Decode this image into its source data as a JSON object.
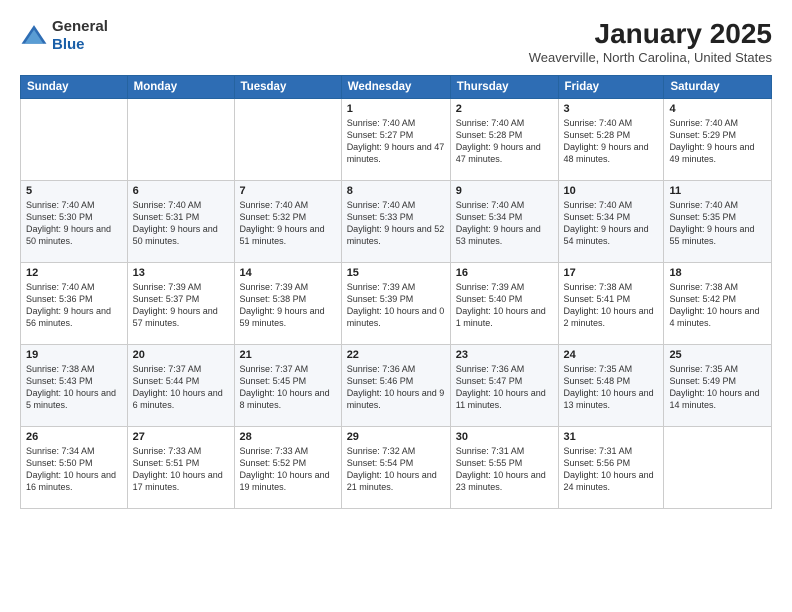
{
  "logo": {
    "general": "General",
    "blue": "Blue"
  },
  "header": {
    "month": "January 2025",
    "location": "Weaverville, North Carolina, United States"
  },
  "days_of_week": [
    "Sunday",
    "Monday",
    "Tuesday",
    "Wednesday",
    "Thursday",
    "Friday",
    "Saturday"
  ],
  "weeks": [
    [
      {
        "day": "",
        "info": ""
      },
      {
        "day": "",
        "info": ""
      },
      {
        "day": "",
        "info": ""
      },
      {
        "day": "1",
        "info": "Sunrise: 7:40 AM\nSunset: 5:27 PM\nDaylight: 9 hours and 47 minutes."
      },
      {
        "day": "2",
        "info": "Sunrise: 7:40 AM\nSunset: 5:28 PM\nDaylight: 9 hours and 47 minutes."
      },
      {
        "day": "3",
        "info": "Sunrise: 7:40 AM\nSunset: 5:28 PM\nDaylight: 9 hours and 48 minutes."
      },
      {
        "day": "4",
        "info": "Sunrise: 7:40 AM\nSunset: 5:29 PM\nDaylight: 9 hours and 49 minutes."
      }
    ],
    [
      {
        "day": "5",
        "info": "Sunrise: 7:40 AM\nSunset: 5:30 PM\nDaylight: 9 hours and 50 minutes."
      },
      {
        "day": "6",
        "info": "Sunrise: 7:40 AM\nSunset: 5:31 PM\nDaylight: 9 hours and 50 minutes."
      },
      {
        "day": "7",
        "info": "Sunrise: 7:40 AM\nSunset: 5:32 PM\nDaylight: 9 hours and 51 minutes."
      },
      {
        "day": "8",
        "info": "Sunrise: 7:40 AM\nSunset: 5:33 PM\nDaylight: 9 hours and 52 minutes."
      },
      {
        "day": "9",
        "info": "Sunrise: 7:40 AM\nSunset: 5:34 PM\nDaylight: 9 hours and 53 minutes."
      },
      {
        "day": "10",
        "info": "Sunrise: 7:40 AM\nSunset: 5:34 PM\nDaylight: 9 hours and 54 minutes."
      },
      {
        "day": "11",
        "info": "Sunrise: 7:40 AM\nSunset: 5:35 PM\nDaylight: 9 hours and 55 minutes."
      }
    ],
    [
      {
        "day": "12",
        "info": "Sunrise: 7:40 AM\nSunset: 5:36 PM\nDaylight: 9 hours and 56 minutes."
      },
      {
        "day": "13",
        "info": "Sunrise: 7:39 AM\nSunset: 5:37 PM\nDaylight: 9 hours and 57 minutes."
      },
      {
        "day": "14",
        "info": "Sunrise: 7:39 AM\nSunset: 5:38 PM\nDaylight: 9 hours and 59 minutes."
      },
      {
        "day": "15",
        "info": "Sunrise: 7:39 AM\nSunset: 5:39 PM\nDaylight: 10 hours and 0 minutes."
      },
      {
        "day": "16",
        "info": "Sunrise: 7:39 AM\nSunset: 5:40 PM\nDaylight: 10 hours and 1 minute."
      },
      {
        "day": "17",
        "info": "Sunrise: 7:38 AM\nSunset: 5:41 PM\nDaylight: 10 hours and 2 minutes."
      },
      {
        "day": "18",
        "info": "Sunrise: 7:38 AM\nSunset: 5:42 PM\nDaylight: 10 hours and 4 minutes."
      }
    ],
    [
      {
        "day": "19",
        "info": "Sunrise: 7:38 AM\nSunset: 5:43 PM\nDaylight: 10 hours and 5 minutes."
      },
      {
        "day": "20",
        "info": "Sunrise: 7:37 AM\nSunset: 5:44 PM\nDaylight: 10 hours and 6 minutes."
      },
      {
        "day": "21",
        "info": "Sunrise: 7:37 AM\nSunset: 5:45 PM\nDaylight: 10 hours and 8 minutes."
      },
      {
        "day": "22",
        "info": "Sunrise: 7:36 AM\nSunset: 5:46 PM\nDaylight: 10 hours and 9 minutes."
      },
      {
        "day": "23",
        "info": "Sunrise: 7:36 AM\nSunset: 5:47 PM\nDaylight: 10 hours and 11 minutes."
      },
      {
        "day": "24",
        "info": "Sunrise: 7:35 AM\nSunset: 5:48 PM\nDaylight: 10 hours and 13 minutes."
      },
      {
        "day": "25",
        "info": "Sunrise: 7:35 AM\nSunset: 5:49 PM\nDaylight: 10 hours and 14 minutes."
      }
    ],
    [
      {
        "day": "26",
        "info": "Sunrise: 7:34 AM\nSunset: 5:50 PM\nDaylight: 10 hours and 16 minutes."
      },
      {
        "day": "27",
        "info": "Sunrise: 7:33 AM\nSunset: 5:51 PM\nDaylight: 10 hours and 17 minutes."
      },
      {
        "day": "28",
        "info": "Sunrise: 7:33 AM\nSunset: 5:52 PM\nDaylight: 10 hours and 19 minutes."
      },
      {
        "day": "29",
        "info": "Sunrise: 7:32 AM\nSunset: 5:54 PM\nDaylight: 10 hours and 21 minutes."
      },
      {
        "day": "30",
        "info": "Sunrise: 7:31 AM\nSunset: 5:55 PM\nDaylight: 10 hours and 23 minutes."
      },
      {
        "day": "31",
        "info": "Sunrise: 7:31 AM\nSunset: 5:56 PM\nDaylight: 10 hours and 24 minutes."
      },
      {
        "day": "",
        "info": ""
      }
    ]
  ]
}
